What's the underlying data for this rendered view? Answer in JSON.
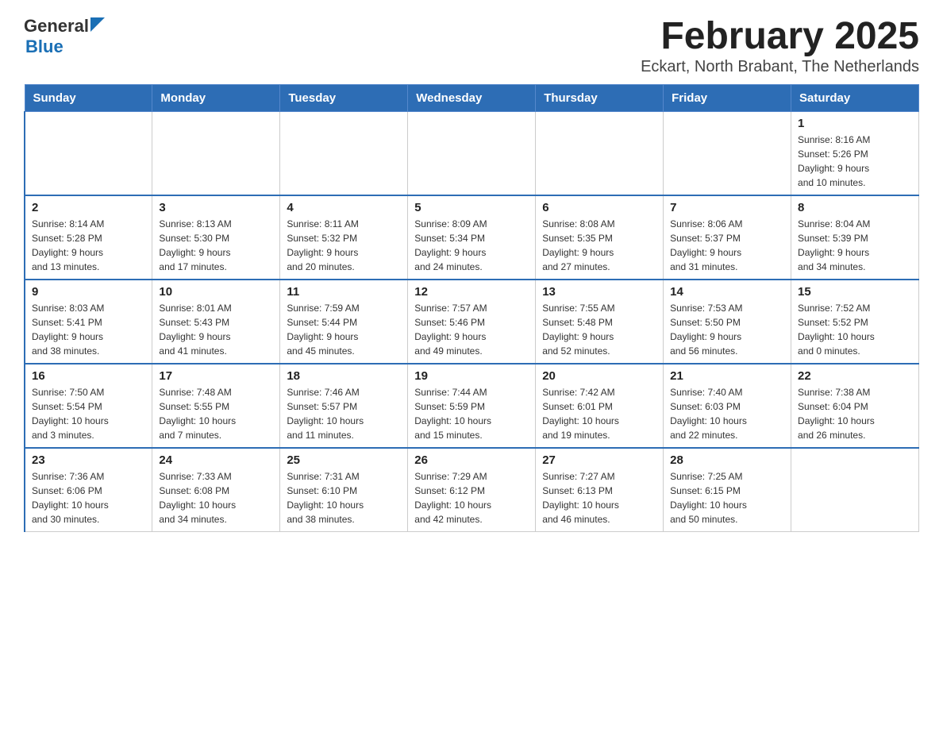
{
  "header": {
    "logo_general": "General",
    "logo_blue": "Blue",
    "month_title": "February 2025",
    "subtitle": "Eckart, North Brabant, The Netherlands"
  },
  "weekdays": [
    "Sunday",
    "Monday",
    "Tuesday",
    "Wednesday",
    "Thursday",
    "Friday",
    "Saturday"
  ],
  "weeks": [
    [
      {
        "day": "",
        "info": ""
      },
      {
        "day": "",
        "info": ""
      },
      {
        "day": "",
        "info": ""
      },
      {
        "day": "",
        "info": ""
      },
      {
        "day": "",
        "info": ""
      },
      {
        "day": "",
        "info": ""
      },
      {
        "day": "1",
        "info": "Sunrise: 8:16 AM\nSunset: 5:26 PM\nDaylight: 9 hours\nand 10 minutes."
      }
    ],
    [
      {
        "day": "2",
        "info": "Sunrise: 8:14 AM\nSunset: 5:28 PM\nDaylight: 9 hours\nand 13 minutes."
      },
      {
        "day": "3",
        "info": "Sunrise: 8:13 AM\nSunset: 5:30 PM\nDaylight: 9 hours\nand 17 minutes."
      },
      {
        "day": "4",
        "info": "Sunrise: 8:11 AM\nSunset: 5:32 PM\nDaylight: 9 hours\nand 20 minutes."
      },
      {
        "day": "5",
        "info": "Sunrise: 8:09 AM\nSunset: 5:34 PM\nDaylight: 9 hours\nand 24 minutes."
      },
      {
        "day": "6",
        "info": "Sunrise: 8:08 AM\nSunset: 5:35 PM\nDaylight: 9 hours\nand 27 minutes."
      },
      {
        "day": "7",
        "info": "Sunrise: 8:06 AM\nSunset: 5:37 PM\nDaylight: 9 hours\nand 31 minutes."
      },
      {
        "day": "8",
        "info": "Sunrise: 8:04 AM\nSunset: 5:39 PM\nDaylight: 9 hours\nand 34 minutes."
      }
    ],
    [
      {
        "day": "9",
        "info": "Sunrise: 8:03 AM\nSunset: 5:41 PM\nDaylight: 9 hours\nand 38 minutes."
      },
      {
        "day": "10",
        "info": "Sunrise: 8:01 AM\nSunset: 5:43 PM\nDaylight: 9 hours\nand 41 minutes."
      },
      {
        "day": "11",
        "info": "Sunrise: 7:59 AM\nSunset: 5:44 PM\nDaylight: 9 hours\nand 45 minutes."
      },
      {
        "day": "12",
        "info": "Sunrise: 7:57 AM\nSunset: 5:46 PM\nDaylight: 9 hours\nand 49 minutes."
      },
      {
        "day": "13",
        "info": "Sunrise: 7:55 AM\nSunset: 5:48 PM\nDaylight: 9 hours\nand 52 minutes."
      },
      {
        "day": "14",
        "info": "Sunrise: 7:53 AM\nSunset: 5:50 PM\nDaylight: 9 hours\nand 56 minutes."
      },
      {
        "day": "15",
        "info": "Sunrise: 7:52 AM\nSunset: 5:52 PM\nDaylight: 10 hours\nand 0 minutes."
      }
    ],
    [
      {
        "day": "16",
        "info": "Sunrise: 7:50 AM\nSunset: 5:54 PM\nDaylight: 10 hours\nand 3 minutes."
      },
      {
        "day": "17",
        "info": "Sunrise: 7:48 AM\nSunset: 5:55 PM\nDaylight: 10 hours\nand 7 minutes."
      },
      {
        "day": "18",
        "info": "Sunrise: 7:46 AM\nSunset: 5:57 PM\nDaylight: 10 hours\nand 11 minutes."
      },
      {
        "day": "19",
        "info": "Sunrise: 7:44 AM\nSunset: 5:59 PM\nDaylight: 10 hours\nand 15 minutes."
      },
      {
        "day": "20",
        "info": "Sunrise: 7:42 AM\nSunset: 6:01 PM\nDaylight: 10 hours\nand 19 minutes."
      },
      {
        "day": "21",
        "info": "Sunrise: 7:40 AM\nSunset: 6:03 PM\nDaylight: 10 hours\nand 22 minutes."
      },
      {
        "day": "22",
        "info": "Sunrise: 7:38 AM\nSunset: 6:04 PM\nDaylight: 10 hours\nand 26 minutes."
      }
    ],
    [
      {
        "day": "23",
        "info": "Sunrise: 7:36 AM\nSunset: 6:06 PM\nDaylight: 10 hours\nand 30 minutes."
      },
      {
        "day": "24",
        "info": "Sunrise: 7:33 AM\nSunset: 6:08 PM\nDaylight: 10 hours\nand 34 minutes."
      },
      {
        "day": "25",
        "info": "Sunrise: 7:31 AM\nSunset: 6:10 PM\nDaylight: 10 hours\nand 38 minutes."
      },
      {
        "day": "26",
        "info": "Sunrise: 7:29 AM\nSunset: 6:12 PM\nDaylight: 10 hours\nand 42 minutes."
      },
      {
        "day": "27",
        "info": "Sunrise: 7:27 AM\nSunset: 6:13 PM\nDaylight: 10 hours\nand 46 minutes."
      },
      {
        "day": "28",
        "info": "Sunrise: 7:25 AM\nSunset: 6:15 PM\nDaylight: 10 hours\nand 50 minutes."
      },
      {
        "day": "",
        "info": ""
      }
    ]
  ]
}
